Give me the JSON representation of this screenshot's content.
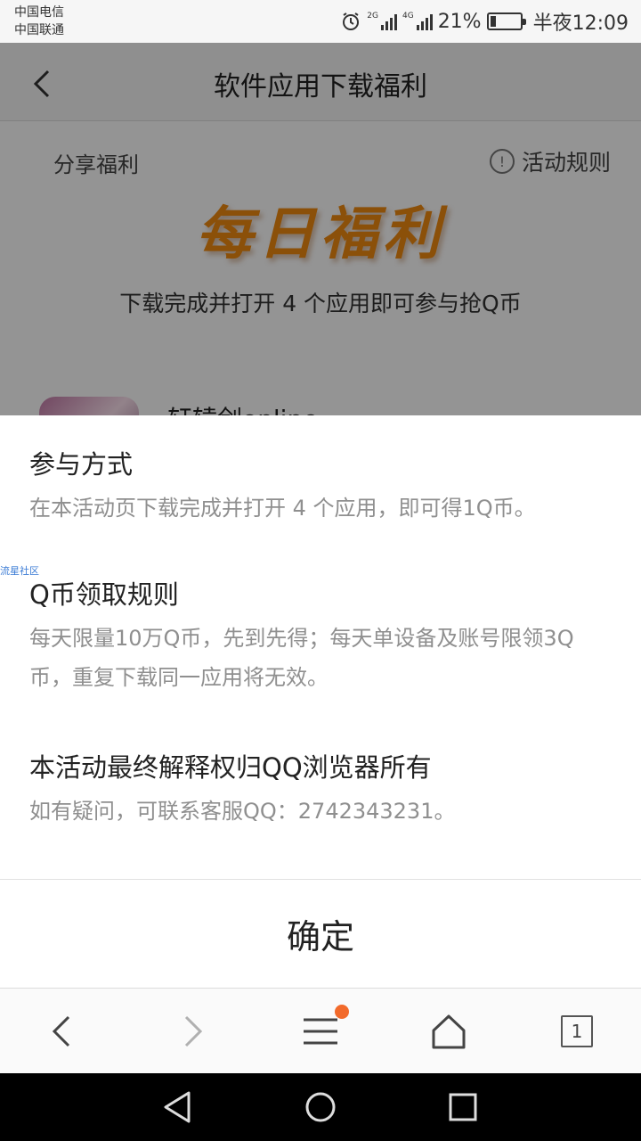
{
  "status_bar": {
    "carrier_1": "中国电信",
    "carrier_2": "中国联通",
    "signal_1_type": "2G",
    "signal_2_type": "4G",
    "battery_percent": "21%",
    "time": "半夜12:09",
    "battery_level": 0.21
  },
  "header": {
    "title": "软件应用下载福利",
    "back_icon": "chevron-left-icon"
  },
  "page": {
    "share_label": "分享福利",
    "rules_label": "活动规则",
    "banner_text": "每日福利",
    "subtitle": "下载完成并打开 4 个应用即可参与抢Q币",
    "app_name": "轩辕剑online"
  },
  "sheet": {
    "watermark": "流星社区",
    "sections": [
      {
        "heading": "参与方式",
        "body": "在本活动页下载完成并打开 4 个应用，即可得1Q币。"
      },
      {
        "heading": "Q币领取规则",
        "body": "每天限量10万Q币，先到先得；每天单设备及账号限领3Q币，重复下载同一应用将无效。"
      },
      {
        "heading": "本活动最终解释权归QQ浏览器所有",
        "body": "如有疑问，可联系客服QQ：2742343231。"
      }
    ],
    "confirm_label": "确定"
  },
  "toolbar": {
    "tab_count": "1",
    "icons": [
      "back-icon",
      "forward-icon",
      "menu-icon",
      "home-icon",
      "tabs-icon"
    ],
    "notification_dot_color": "#f26a2b"
  },
  "colors": {
    "banner_orange": "#f08a10",
    "overlay": "rgba(0,0,0,0.42)"
  }
}
